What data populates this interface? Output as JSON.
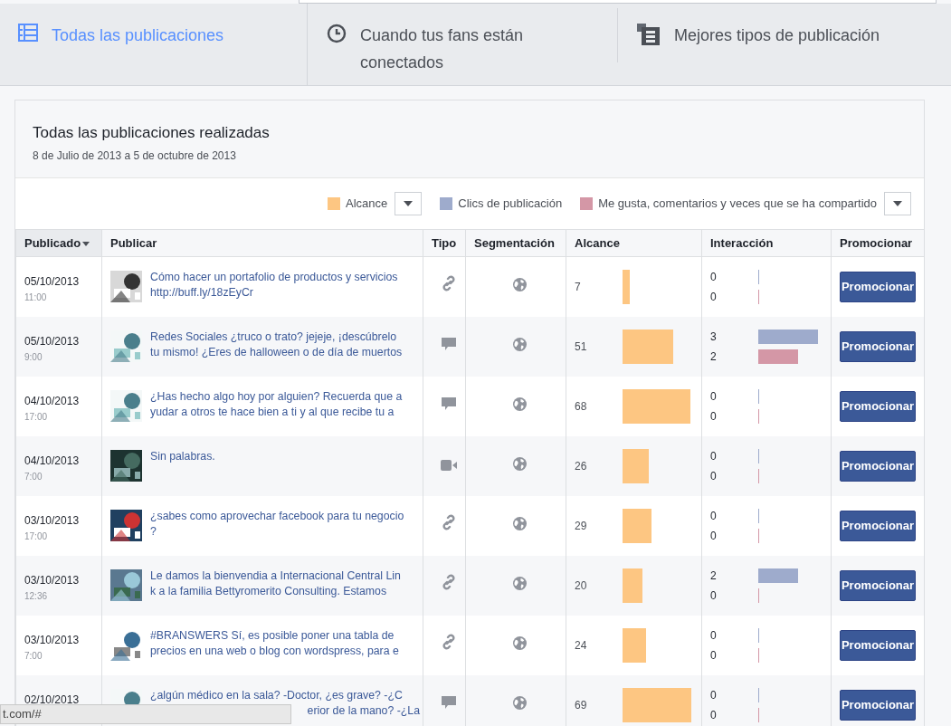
{
  "tabs": [
    {
      "label": "Todas las publicaciones",
      "selected": true
    },
    {
      "label": "Cuando tus fans están conectados",
      "selected": false
    },
    {
      "label": "Mejores tipos de publicación",
      "selected": false
    }
  ],
  "panel": {
    "title": "Todas las publicaciones realizadas",
    "subtitle": "8 de Julio de 2013 a 5 de octubre de 2013"
  },
  "legend": [
    {
      "label": "Alcance",
      "color": "#fdc682",
      "dropdown": true
    },
    {
      "label": "Clics de publicación",
      "color": "#9eabcc",
      "dropdown": false
    },
    {
      "label": "Me gusta, comentarios y veces que se ha compartido",
      "color": "#d497a6",
      "dropdown": true
    }
  ],
  "table": {
    "columns": [
      {
        "label": "Publicado",
        "sorted": true
      },
      {
        "label": "Publicar",
        "sorted": false
      },
      {
        "label": "Tipo",
        "sorted": false
      },
      {
        "label": "Segmentación",
        "sorted": false
      },
      {
        "label": "Alcance",
        "sorted": false
      },
      {
        "label": "Interacción",
        "sorted": false
      },
      {
        "label": "Promocionar",
        "sorted": false
      }
    ],
    "rows": [
      {
        "date": "05/10/2013",
        "time": "11:00",
        "text": [
          "Cómo hacer un portafolio de productos y servicios",
          "http://buff.ly/18zEyCr"
        ],
        "kind": "link",
        "reach": "7",
        "clicks": "0",
        "likes": "0",
        "button": "Promocionar"
      },
      {
        "date": "05/10/2013",
        "time": "9:00",
        "text": [
          "Redes Sociales ¿truco o trato? jejeje, ¡descúbrelo",
          "tu mismo! ¿Eres de halloween o de día de muertos"
        ],
        "kind": "status",
        "reach": "51",
        "clicks": "3",
        "likes": "2",
        "button": "Promocionar"
      },
      {
        "date": "04/10/2013",
        "time": "17:00",
        "text": [
          "¿Has hecho algo hoy por alguien? Recuerda que a",
          "yudar a otros te hace bien a ti y al que recibe tu a"
        ],
        "kind": "status",
        "reach": "68",
        "clicks": "0",
        "likes": "0",
        "button": "Promocionar"
      },
      {
        "date": "04/10/2013",
        "time": "7:00",
        "text": [
          "Sin palabras."
        ],
        "kind": "video",
        "reach": "26",
        "clicks": "0",
        "likes": "0",
        "button": "Promocionar"
      },
      {
        "date": "03/10/2013",
        "time": "17:00",
        "text": [
          "¿sabes como aprovechar facebook para tu negocio",
          "?"
        ],
        "kind": "link",
        "reach": "29",
        "clicks": "0",
        "likes": "0",
        "button": "Promocionar"
      },
      {
        "date": "03/10/2013",
        "time": "12:36",
        "text": [
          "Le damos la bienvendia a Internacional Central Lin",
          "k a la familia Bettyromerito Consulting. Estamos"
        ],
        "kind": "link",
        "reach": "20",
        "clicks": "2",
        "likes": "0",
        "button": "Promocionar"
      },
      {
        "date": "03/10/2013",
        "time": "7:00",
        "text": [
          "#BRANSWERS Sí, es posible poner una tabla de",
          "precios en una web o blog con wordspress, para e"
        ],
        "kind": "link",
        "reach": "24",
        "clicks": "0",
        "likes": "0",
        "button": "Promocionar"
      },
      {
        "date": "02/10/2013",
        "text": [
          "¿algún médico en la sala? -Doctor, ¿es grave? -¿C",
          "erior de la mano? -¿La"
        ],
        "kind": "status",
        "reach": "69",
        "clicks": "0",
        "likes": "0",
        "button": "Promocionar"
      }
    ]
  },
  "status_bar": {
    "url": "t.com/#"
  }
}
